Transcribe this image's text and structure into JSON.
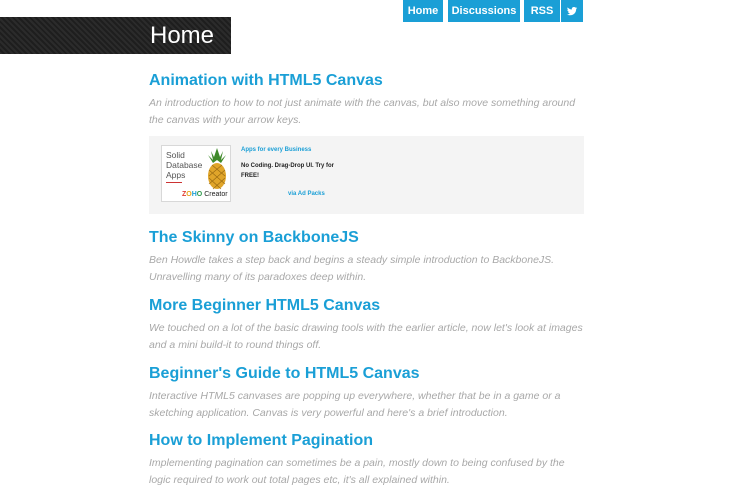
{
  "nav": {
    "items": [
      {
        "label": "Home"
      },
      {
        "label": "Discussions"
      },
      {
        "label": "RSS"
      }
    ],
    "twitter_icon": "twitter-bird-icon"
  },
  "header": {
    "title": "Home"
  },
  "articles": [
    {
      "title": "Animation with HTML5 Canvas",
      "excerpt": "An introduction to how to not just animate with the canvas, but also move something around the canvas with your arrow keys."
    },
    {
      "title": "The Skinny on BackboneJS",
      "excerpt": "Ben Howdle takes a step back and begins a steady simple introduction to BackboneJS. Unravelling many of its paradoxes deep within."
    },
    {
      "title": "More Beginner HTML5 Canvas",
      "excerpt": "We touched on a lot of the basic drawing tools with the earlier article, now let's look at images and a mini build-it to round things off."
    },
    {
      "title": "Beginner's Guide to HTML5 Canvas",
      "excerpt": "Interactive HTML5 canvases are popping up everywhere, whether that be in a game or a sketching application. Canvas is very powerful and here's a brief introduction."
    },
    {
      "title": "How to Implement Pagination",
      "excerpt": "Implementing pagination can sometimes be a pain, mostly down to being confused by the logic required to work out total pages etc, it's all explained within."
    }
  ],
  "ad": {
    "image_text": "Solid Database Apps",
    "brand_z": "Z",
    "brand_o1": "O",
    "brand_h": "H",
    "brand_o2": "O",
    "brand_product": "Creator",
    "headline": "Apps for every Business",
    "body": "No Coding. Drag-Drop UI. Try for FREE!",
    "via": "via Ad Packs"
  },
  "colors": {
    "accent": "#1a9fd6",
    "excerpt": "#a8a8a8",
    "header_band": "#1e1e1e",
    "ad_bg": "#f4f4f4"
  }
}
